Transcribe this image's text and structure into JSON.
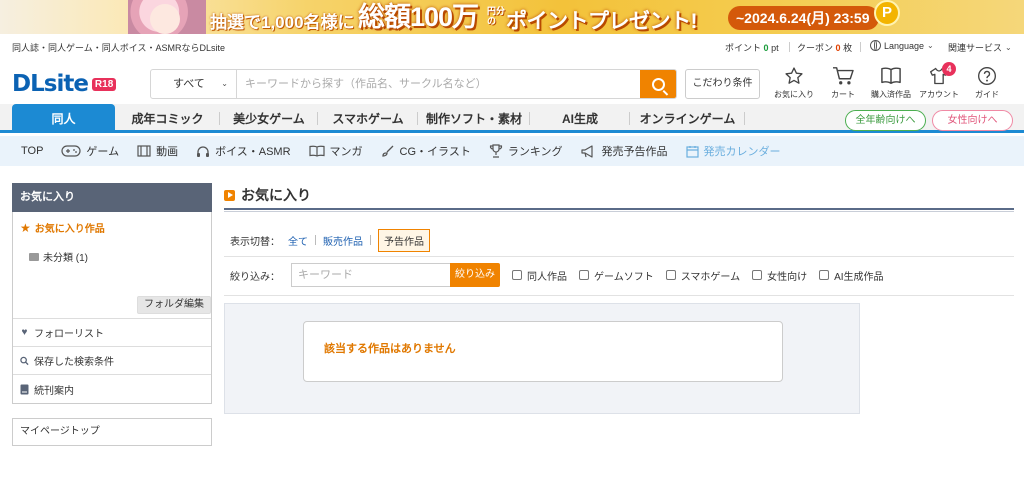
{
  "banner": {
    "text1": "抽選で1,000名様に",
    "text2": "総額100万",
    "small": "円分の",
    "text3": "ポイントプレゼント!",
    "date": "~2024.6.24(月) 23:59",
    "coin": "P"
  },
  "utility": {
    "tagline": "同人誌・同人ゲーム・同人ボイス・ASMRならDLsite",
    "points_label": "ポイント",
    "points_value": "0",
    "points_unit": "pt",
    "coupon_label": "クーポン",
    "coupon_value": "0",
    "coupon_unit": "枚",
    "language": "Language",
    "services": "関連サービス"
  },
  "header": {
    "logo": "DLsite",
    "logo_badge": "R18",
    "search_category": "すべて",
    "search_placeholder": "キーワードから探す（作品名、サークル名など）",
    "advanced_label": "こだわり条件",
    "icons": {
      "favorites": "お気に入り",
      "cart": "カート",
      "purchased": "購入済作品",
      "account": "アカウント",
      "account_badge": "4",
      "guide": "ガイド"
    }
  },
  "floor_tabs": [
    {
      "label": "同人"
    },
    {
      "label": "成年コミック"
    },
    {
      "label": "美少女ゲーム"
    },
    {
      "label": "スマホゲーム"
    },
    {
      "label": "制作ソフト・素材"
    },
    {
      "label": "AI生成"
    },
    {
      "label": "オンラインゲーム"
    }
  ],
  "floor_pills": {
    "all_ages": "全年齢向けへ",
    "female": "女性向けへ"
  },
  "subnav": [
    {
      "label": "TOP",
      "icon": ""
    },
    {
      "label": "ゲーム",
      "icon": "gamepad-icon"
    },
    {
      "label": "動画",
      "icon": "film-icon"
    },
    {
      "label": "ボイス・ASMR",
      "icon": "headphones-icon"
    },
    {
      "label": "マンガ",
      "icon": "book-icon"
    },
    {
      "label": "CG・イラスト",
      "icon": "brush-icon"
    },
    {
      "label": "ランキング",
      "icon": "trophy-icon"
    },
    {
      "label": "発売予告作品",
      "icon": "megaphone-icon"
    },
    {
      "label": "発売カレンダー",
      "icon": "calendar-icon"
    }
  ],
  "sidebar": {
    "header": "お気に入り",
    "fav_works": "お気に入り作品",
    "folder": "未分類 (1)",
    "folder_edit": "フォルダ編集",
    "follow_list": "フォローリスト",
    "saved_search": "保存した検索条件",
    "series": "続刊案内",
    "mypage": "マイページトップ"
  },
  "main": {
    "title": "お気に入り",
    "switch_label": "表示切替：",
    "switch_all": "全て",
    "switch_sale": "販売作品",
    "switch_announce": "予告作品",
    "filter_label": "絞り込み：",
    "filter_placeholder": "キーワード",
    "filter_button": "絞り込み",
    "checkboxes": [
      "同人作品",
      "ゲームソフト",
      "スマホゲーム",
      "女性向け",
      "AI生成作品"
    ],
    "empty_message": "該当する作品はありません"
  },
  "colors": {
    "accent": "#f08300",
    "brand_blue": "#1c8ad3",
    "sidebar_head": "#596477"
  }
}
